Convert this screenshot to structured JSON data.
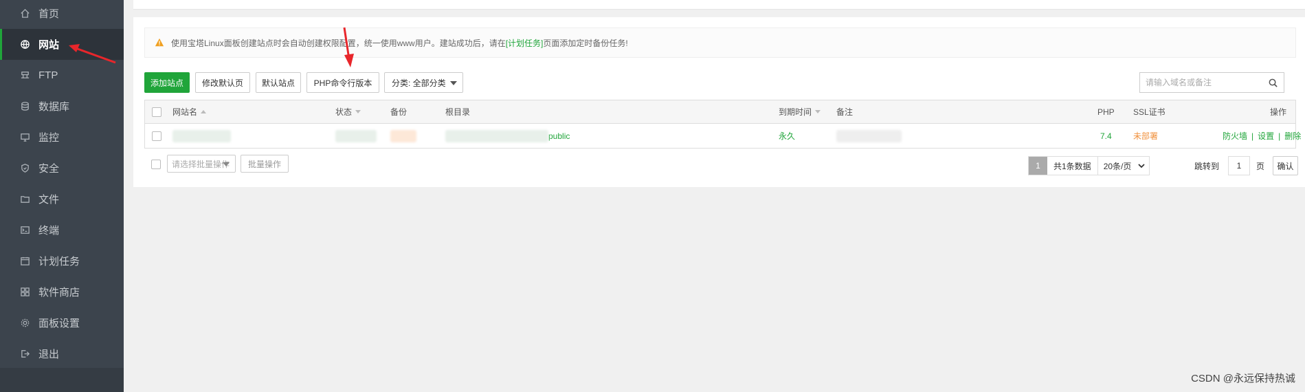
{
  "sidebar": {
    "items": [
      {
        "label": "首页",
        "icon": "home-icon"
      },
      {
        "label": "网站",
        "icon": "globe-icon",
        "active": true
      },
      {
        "label": "FTP",
        "icon": "ftp-icon"
      },
      {
        "label": "数据库",
        "icon": "database-icon"
      },
      {
        "label": "监控",
        "icon": "monitor-icon"
      },
      {
        "label": "安全",
        "icon": "shield-icon"
      },
      {
        "label": "文件",
        "icon": "folder-icon"
      },
      {
        "label": "终端",
        "icon": "terminal-icon"
      },
      {
        "label": "计划任务",
        "icon": "calendar-icon"
      },
      {
        "label": "软件商店",
        "icon": "grid-icon"
      },
      {
        "label": "面板设置",
        "icon": "gear-icon"
      },
      {
        "label": "退出",
        "icon": "logout-icon"
      }
    ]
  },
  "notice": {
    "text_before": "使用宝塔Linux面板创建站点时会自动创建权限配置，统一使用www用户。建站成功后，请在",
    "link": "[计划任务]",
    "text_after": "页面添加定时备份任务!"
  },
  "toolbar": {
    "add_site": "添加站点",
    "modify_default_page": "修改默认页",
    "default_site": "默认站点",
    "php_cli_version": "PHP命令行版本",
    "category_select": "分类: 全部分类"
  },
  "search": {
    "placeholder": "请输入域名或备注"
  },
  "table": {
    "headers": {
      "site_name": "网站名",
      "status": "状态",
      "backup": "备份",
      "root_dir": "根目录",
      "expire": "到期时间",
      "remark": "备注",
      "php": "PHP",
      "ssl": "SSL证书",
      "actions": "操作"
    },
    "rows": [
      {
        "root_suffix": "public",
        "expire": "永久",
        "php": "7.4",
        "ssl": "未部署",
        "action_firewall": "防火墙",
        "action_settings": "设置",
        "action_delete": "删除"
      }
    ]
  },
  "bulk": {
    "select_placeholder": "请选择批量操作",
    "button": "批量操作"
  },
  "pagination": {
    "current_page": "1",
    "total": "共1条数据",
    "per_page": "20条/页",
    "jump_to": "跳转到",
    "jump_value": "1",
    "page_suffix": "页",
    "confirm": "确认"
  },
  "watermark": "CSDN @永远保持热诚",
  "colors": {
    "sidebar_bg": "#3c444d",
    "accent_green": "#20a53a",
    "ssl_orange": "#f0913d",
    "arrow_red": "#e8262b"
  }
}
